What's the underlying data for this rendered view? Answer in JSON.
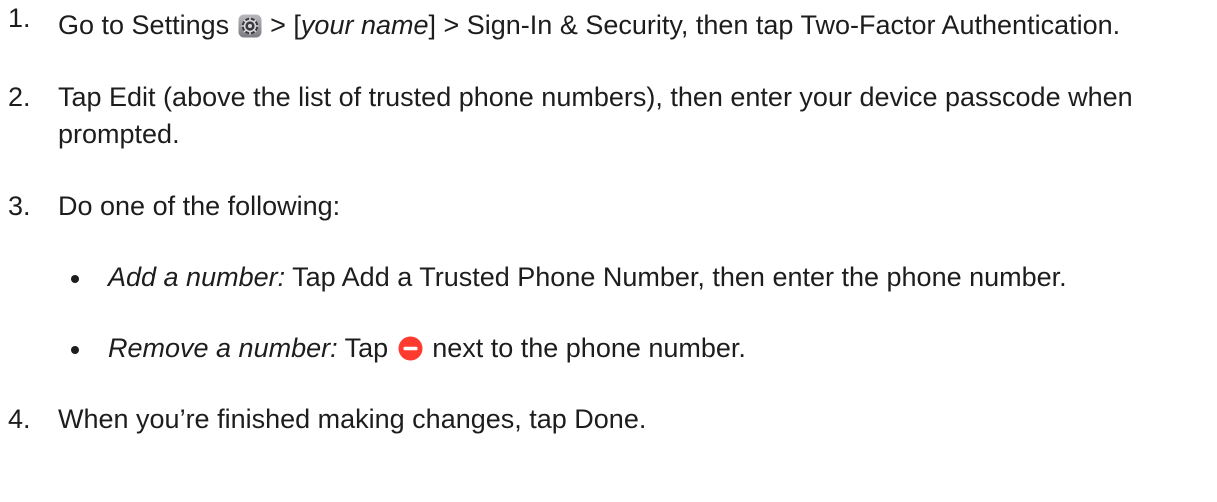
{
  "steps": [
    {
      "num": "1.",
      "pre": "Go to Settings",
      "mid_a": "> [",
      "name_em": "your name",
      "mid_b": "] > Sign-In & Security, then tap Two-Factor Authentication."
    },
    {
      "num": "2.",
      "text": "Tap Edit (above the list of trusted phone numbers), then enter your device passcode when prompted."
    },
    {
      "num": "3.",
      "text": "Do one of the following:",
      "options": [
        {
          "label_em": "Add a number:",
          "text": "Tap Add a Trusted Phone Number, then enter the phone number."
        },
        {
          "label_em": "Remove a number:",
          "pre": "Tap",
          "post": "next to the phone number."
        }
      ]
    },
    {
      "num": "4.",
      "text": "When you’re finished making changes, tap Done."
    }
  ],
  "icons": {
    "settings": "settings-gear-icon",
    "remove": "remove-minus-circle-icon"
  },
  "colors": {
    "text": "#1d1d1f",
    "remove_red": "#ff3b30"
  }
}
